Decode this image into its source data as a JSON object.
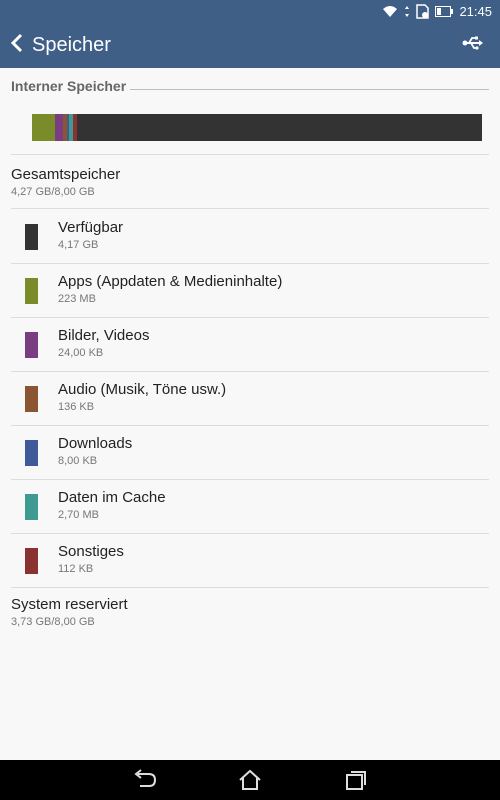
{
  "status_bar": {
    "time": "21:45",
    "icons": [
      "wifi-icon",
      "data-arrows-icon",
      "sd-card-icon",
      "battery-icon"
    ]
  },
  "action_bar": {
    "title": "Speicher",
    "back_icon": "chevron-left-icon",
    "usb_icon": "usb-icon"
  },
  "section": {
    "title": "Interner Speicher"
  },
  "usage_bar": {
    "segments": [
      {
        "name": "Apps",
        "color": "#7a8c2a",
        "fraction": 0.051
      },
      {
        "name": "Bilder, Videos",
        "color": "#7b3d82",
        "fraction": 0.018
      },
      {
        "name": "Audio",
        "color": "#8a5530",
        "fraction": 0.009
      },
      {
        "name": "Downloads",
        "color": "#3f5a99",
        "fraction": 0.004
      },
      {
        "name": "Daten im Cache",
        "color": "#3f9a92",
        "fraction": 0.009
      },
      {
        "name": "Sonstiges",
        "color": "#8a3232",
        "fraction": 0.009
      },
      {
        "name": "Verfügbar",
        "color": "#333333",
        "fraction": 0.9
      }
    ]
  },
  "total": {
    "label": "Gesamtspeicher",
    "value": "4,27 GB/8,00 GB"
  },
  "categories": [
    {
      "label": "Verfügbar",
      "value": "4,17 GB",
      "color": "#333333"
    },
    {
      "label": "Apps (Appdaten & Medieninhalte)",
      "value": "223 MB",
      "color": "#7a8c2a"
    },
    {
      "label": "Bilder, Videos",
      "value": "24,00 KB",
      "color": "#7b3d82"
    },
    {
      "label": "Audio (Musik, Töne usw.)",
      "value": "136 KB",
      "color": "#8a5530"
    },
    {
      "label": "Downloads",
      "value": "8,00 KB",
      "color": "#3f5a99"
    },
    {
      "label": "Daten im Cache",
      "value": "2,70 MB",
      "color": "#3f9a92"
    },
    {
      "label": "Sonstiges",
      "value": "112 KB",
      "color": "#8a3232"
    }
  ],
  "system": {
    "label": "System reserviert",
    "value": "3,73 GB/8,00 GB"
  },
  "nav_bar": {
    "icons": [
      "back-icon",
      "home-icon",
      "recent-apps-icon"
    ]
  },
  "colors": {
    "accent": "#3f5f87",
    "background": "#f8f8f8"
  }
}
